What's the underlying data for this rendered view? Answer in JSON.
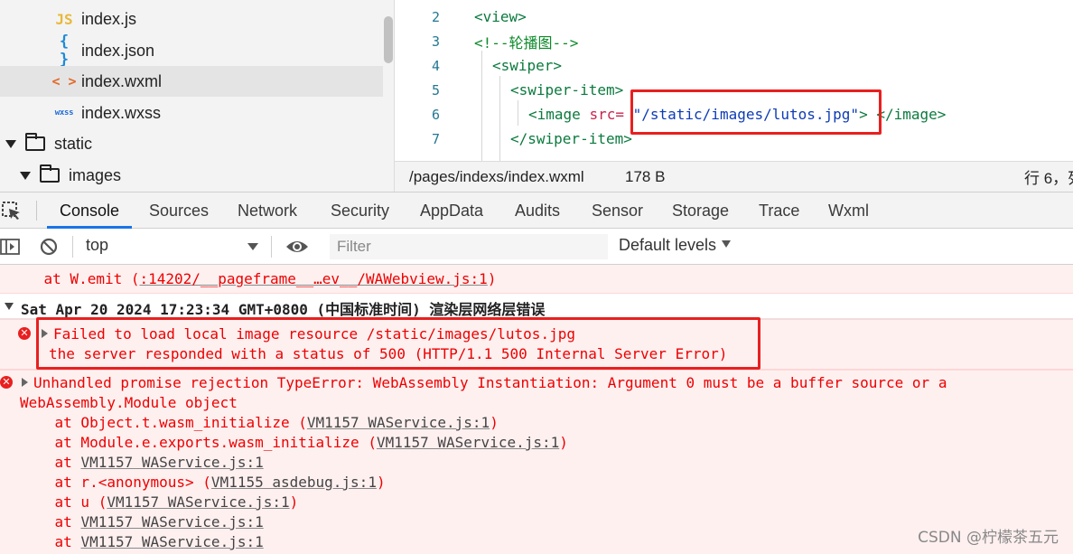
{
  "file_tree": {
    "items": [
      {
        "label": "index.js",
        "icon": "js-file-icon",
        "icon_text": "JS"
      },
      {
        "label": "index.json",
        "icon": "json-file-icon",
        "icon_text": "{ }"
      },
      {
        "label": "index.wxml",
        "icon": "wxml-file-icon",
        "icon_text": "< >",
        "selected": true
      },
      {
        "label": "index.wxss",
        "icon": "wxss-file-icon",
        "icon_text": "wxss"
      },
      {
        "label": "static",
        "icon": "folder-icon",
        "expanded": true
      },
      {
        "label": "images",
        "icon": "folder-icon",
        "expanded": true
      }
    ]
  },
  "editor": {
    "lines": [
      {
        "num": "2",
        "code": "<view>"
      },
      {
        "num": "3",
        "code": "<!--轮播图-->"
      },
      {
        "num": "4",
        "code": "<swiper>"
      },
      {
        "num": "5",
        "code": "<swiper-item>"
      },
      {
        "num": "6",
        "code_tag": "<image ",
        "code_attr": "src=",
        "code_str": "\"/static/images/lutos.jpg\"",
        "code_close": "> </image>"
      },
      {
        "num": "7",
        "code": "</swiper-item>"
      }
    ]
  },
  "statusbar": {
    "path": "/pages/indexs/index.wxml",
    "size": "178 B",
    "position": "行 6，列"
  },
  "devtools": {
    "tabs": [
      "Console",
      "Sources",
      "Network",
      "Security",
      "AppData",
      "Audits",
      "Sensor",
      "Storage",
      "Trace",
      "Wxml"
    ],
    "active_tab": "Console",
    "context": "top",
    "filter_placeholder": "Filter",
    "levels": "Default levels"
  },
  "console": {
    "top_partial": "    at W.emit (",
    "top_partial_link": ":14202/__pageframe__…ev__/WAWebview.js:1",
    "top_partial_end": ")",
    "group_header": "Sat Apr 20 2024 17:23:34 GMT+0800 (中国标准时间) 渲染层网络层错误",
    "error1_line1": "Failed to load local image resource /static/images/lutos.jpg",
    "error1_line2": "the server responded with a status of 500 (HTTP/1.1 500 Internal Server Error)",
    "error2_line1": "Unhandled promise rejection TypeError: WebAssembly Instantiation: Argument 0 must be a buffer source or a",
    "error2_line2": "WebAssembly.Module object",
    "stack": [
      {
        "pre": "    at Object.t.wasm_initialize (",
        "link": "VM1157 WAService.js:1",
        "post": ")"
      },
      {
        "pre": "    at Module.e.exports.wasm_initialize (",
        "link": "VM1157 WAService.js:1",
        "post": ")"
      },
      {
        "pre": "    at ",
        "link": "VM1157 WAService.js:1",
        "post": ""
      },
      {
        "pre": "    at r.<anonymous> (",
        "link": "VM1155 asdebug.js:1",
        "post": ")"
      },
      {
        "pre": "    at u (",
        "link": "VM1157 WAService.js:1",
        "post": ")"
      },
      {
        "pre": "    at ",
        "link": "VM1157 WAService.js:1",
        "post": ""
      },
      {
        "pre": "    at ",
        "link": "VM1157 WAService.js:1",
        "post": ""
      }
    ]
  },
  "watermark": "CSDN @柠檬茶五元",
  "colors": {
    "highlight": "#e8201f",
    "error_text": "#ee0000",
    "active_tab": "#1a73e8"
  }
}
